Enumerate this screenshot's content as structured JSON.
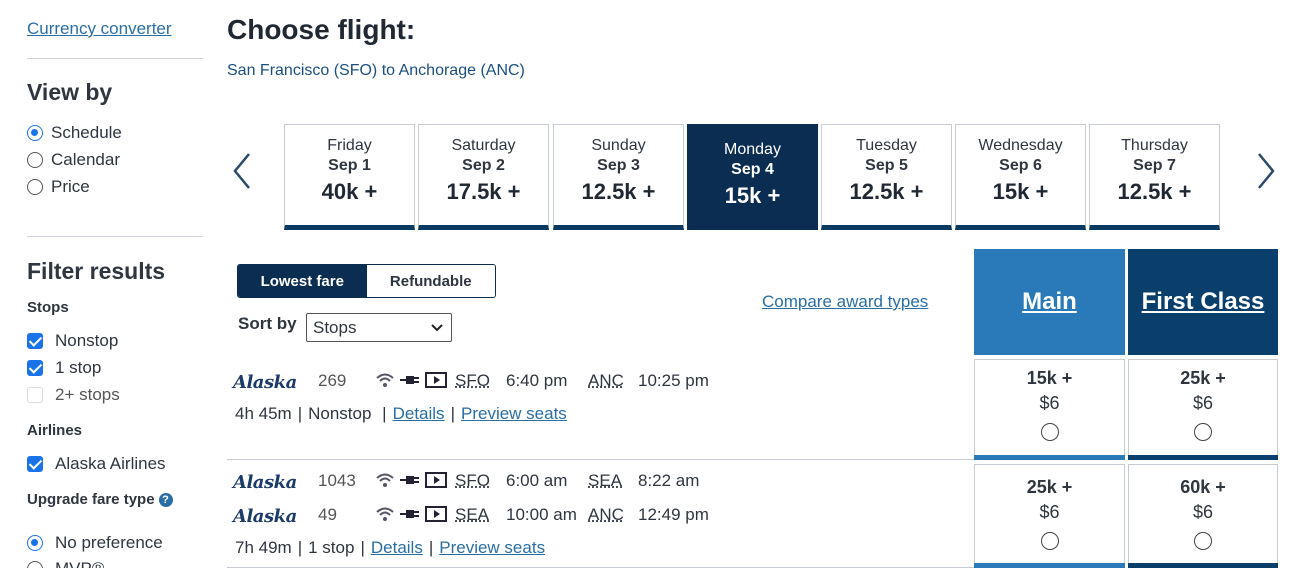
{
  "sidebar": {
    "currency_link": "Currency converter",
    "view_by": {
      "heading": "View by",
      "options": [
        "Schedule",
        "Calendar",
        "Price"
      ],
      "selected": "Schedule"
    },
    "filter": {
      "heading": "Filter results",
      "stops_heading": "Stops",
      "stops": [
        "Nonstop",
        "1 stop",
        "2+ stops"
      ],
      "airlines_heading": "Airlines",
      "airline": "Alaska Airlines",
      "upgrade_heading": "Upgrade fare type",
      "upgrade_options": [
        "No preference",
        "MVP®"
      ]
    }
  },
  "header": {
    "title": "Choose flight:",
    "route": "San Francisco (SFO) to Anchorage (ANC)"
  },
  "dates": [
    {
      "day": "Friday",
      "date": "Sep 1",
      "price": "40k +"
    },
    {
      "day": "Saturday",
      "date": "Sep 2",
      "price": "17.5k +"
    },
    {
      "day": "Sunday",
      "date": "Sep 3",
      "price": "12.5k +"
    },
    {
      "day": "Monday",
      "date": "Sep 4",
      "price": "15k +"
    },
    {
      "day": "Tuesday",
      "date": "Sep 5",
      "price": "12.5k +"
    },
    {
      "day": "Wednesday",
      "date": "Sep 6",
      "price": "15k +"
    },
    {
      "day": "Thursday",
      "date": "Sep 7",
      "price": "12.5k +"
    }
  ],
  "fare_toggle": {
    "lowest": "Lowest fare",
    "refundable": "Refundable"
  },
  "sort": {
    "label": "Sort by",
    "value": "Stops"
  },
  "compare_link": "Compare award types",
  "cabins": {
    "main": "Main",
    "first": "First Class"
  },
  "airline_logo": "Alaska",
  "flights": [
    {
      "segments": [
        {
          "number": "269",
          "from": "SFO",
          "depart": "6:40 pm",
          "to": "ANC",
          "arrive": "10:25 pm"
        }
      ],
      "duration": "4h 45m",
      "stops": "Nonstop",
      "details": "Details",
      "preview": "Preview seats",
      "main": {
        "points": "15k +",
        "fee": "$6"
      },
      "first": {
        "points": "25k +",
        "fee": "$6"
      }
    },
    {
      "segments": [
        {
          "number": "1043",
          "from": "SFO",
          "depart": "6:00 am",
          "to": "SEA",
          "arrive": "8:22 am"
        },
        {
          "number": "49",
          "from": "SEA",
          "depart": "10:00 am",
          "to": "ANC",
          "arrive": "12:49 pm"
        }
      ],
      "duration": "7h 49m",
      "stops": "1 stop",
      "details": "Details",
      "preview": "Preview seats",
      "main": {
        "points": "25k +",
        "fee": "$6"
      },
      "first": {
        "points": "60k +",
        "fee": "$6"
      }
    }
  ],
  "colors": {
    "navy": "#0b2d52",
    "main_blue": "#2a79b8",
    "first_blue": "#0b3f6b",
    "link": "#2a6ea6"
  }
}
